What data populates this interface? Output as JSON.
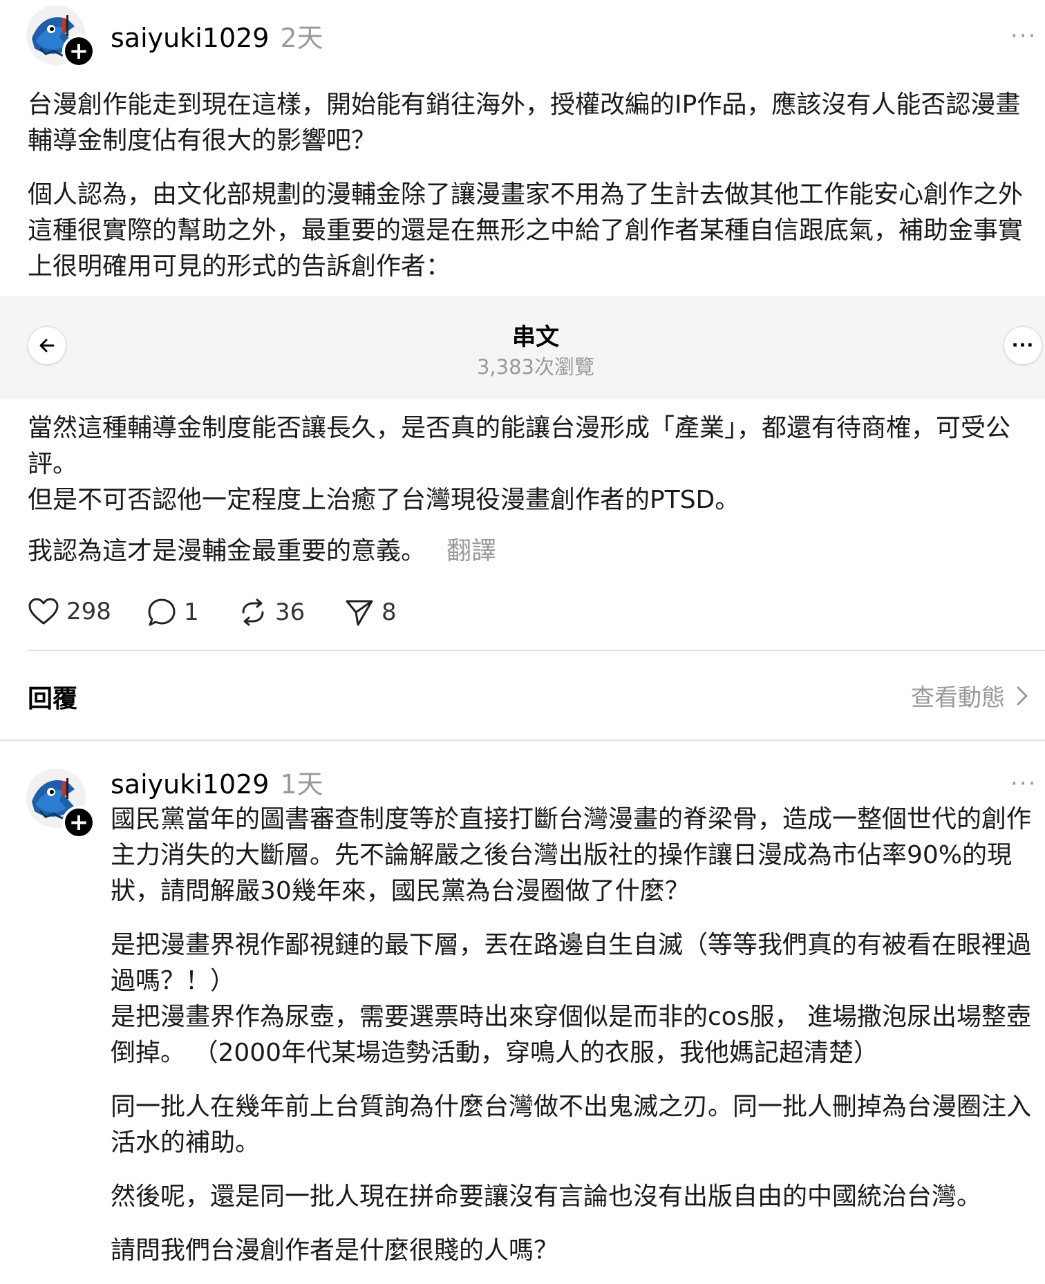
{
  "post": {
    "username": "saiyuki1029",
    "time": "2天",
    "more_label": "···",
    "paragraphs": [
      "台漫創作能走到現在這樣，開始能有銷往海外，授權改編的IP作品，應該沒有人能否認漫畫輔導金制度佔有很大的影響吧？",
      "個人認為，由文化部規劃的漫輔金除了讓漫畫家不用為了生計去做其他工作能安心創作之外這種很實際的幫助之外，最重要的還是在無形之中給了創作者某種自信跟底氣，補助金事實上很明確用可見的形式的告訴創作者："
    ],
    "paragraphs_after": [
      "當然這種輔導金制度能否讓長久，是否真的能讓台漫形成「產業」，都還有待商榷，可受公評。",
      "但是不可否認他一定程度上治癒了台灣現役漫畫創作者的PTSD。",
      "我認為這才是漫輔金最重要的意義。"
    ],
    "translate_label": "翻譯",
    "likes": "298",
    "replies": "1",
    "reposts": "36",
    "shares": "8"
  },
  "thread_header": {
    "title": "串文",
    "views": "3,383次瀏覽",
    "more_label": "···"
  },
  "replies_section": {
    "title": "回覆",
    "activity_label": "查看動態"
  },
  "reply": {
    "username": "saiyuki1029",
    "time": "1天",
    "more_label": "···",
    "paragraphs": [
      "國民黨當年的圖書審查制度等於直接打斷台灣漫畫的脊梁骨，造成一整個世代的創作主力消失的大斷層。先不論解嚴之後台灣出版社的操作讓日漫成為市佔率90%的現狀，請問解嚴30幾年來，國民黨為台漫圈做了什麼？",
      "是把漫畫界視作鄙視鏈的最下層，丟在路邊自生自滅（等等我們真的有被看在眼裡過過嗎？！）",
      "是把漫畫界作為尿壺，需要選票時出來穿個似是而非的cos服， 進場撒泡尿出場整壺倒掉。 （2000年代某場造勢活動，穿鳴人的衣服，我他媽記超清楚）",
      "同一批人在幾年前上台質詢為什麼台灣做不出鬼滅之刃。同一批人刪掉為台漫圈注入活水的補助。",
      "然後呢，還是同一批人現在拼命要讓沒有言論也沒有出版自由的中國統治台灣。",
      "請問我們台漫創作者是什麼很賤的人嗎？"
    ]
  },
  "colors": {
    "muted": "#999999",
    "overlay_bg": "#f5f5f5",
    "divider": "#e3e3e3"
  }
}
